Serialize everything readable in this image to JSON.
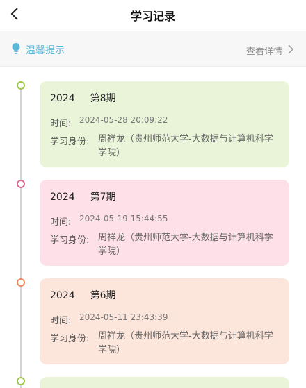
{
  "nav": {
    "title": "学习记录"
  },
  "tip": {
    "text": "温馨提示",
    "detail": "查看详情"
  },
  "colors": {
    "green": "#9dc84a",
    "pink": "#d96b96",
    "orange": "#ec8a5a"
  },
  "records": [
    {
      "year": "2024",
      "period": "第8期",
      "time_label": "时间:",
      "time": "2024-05-28 20:09:22",
      "id_label": "学习身份:",
      "id_value": "周祥龙（贵州师范大学-大数据与计算机科学学院）"
    },
    {
      "year": "2024",
      "period": "第7期",
      "time_label": "时间:",
      "time": "2024-05-19 15:44:55",
      "id_label": "学习身份:",
      "id_value": "周祥龙（贵州师范大学-大数据与计算机科学学院）"
    },
    {
      "year": "2024",
      "period": "第6期",
      "time_label": "时间:",
      "time": "2024-05-11 23:43:39",
      "id_label": "学习身份:",
      "id_value": "周祥龙（贵州师范大学-大数据与计算机科学学院）"
    }
  ]
}
